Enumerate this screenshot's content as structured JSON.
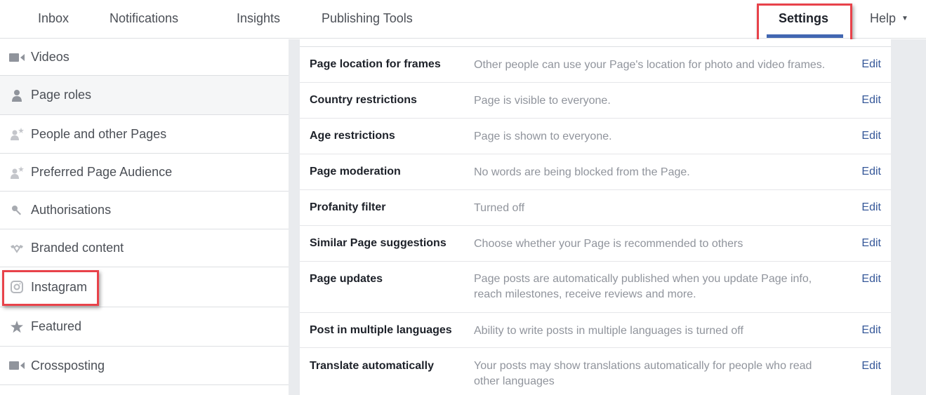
{
  "topnav": {
    "items": [
      {
        "label": "Inbox"
      },
      {
        "label": "Notifications"
      },
      {
        "label": "Insights"
      },
      {
        "label": "Publishing Tools"
      }
    ],
    "settings_label": "Settings",
    "help_label": "Help",
    "help_caret": "▼",
    "active": "Settings",
    "accent_color": "#4267b2",
    "highlight_color": "#e8424a"
  },
  "sidebar": {
    "items": [
      {
        "label": "Videos",
        "icon": "video-camera-icon"
      },
      {
        "label": "Page roles",
        "icon": "person-icon",
        "selected": true
      },
      {
        "label": "People and other Pages",
        "icon": "person-star-icon"
      },
      {
        "label": "Preferred Page Audience",
        "icon": "person-star-icon"
      },
      {
        "label": "Authorisations",
        "icon": "key-icon"
      },
      {
        "label": "Branded content",
        "icon": "handshake-icon"
      },
      {
        "label": "Instagram",
        "icon": "instagram-icon",
        "highlighted": true
      },
      {
        "label": "Featured",
        "icon": "star-icon"
      },
      {
        "label": "Crossposting",
        "icon": "video-camera-icon"
      }
    ]
  },
  "settings": {
    "edit_label": "Edit",
    "rows": [
      {
        "title": "Page location for frames",
        "description": "Other people can use your Page's location for photo and video frames."
      },
      {
        "title": "Country restrictions",
        "description": "Page is visible to everyone."
      },
      {
        "title": "Age restrictions",
        "description": "Page is shown to everyone."
      },
      {
        "title": "Page moderation",
        "description": "No words are being blocked from the Page."
      },
      {
        "title": "Profanity filter",
        "description": "Turned off"
      },
      {
        "title": "Similar Page suggestions",
        "description": "Choose whether your Page is recommended to others"
      },
      {
        "title": "Page updates",
        "description": "Page posts are automatically published when you update Page info, reach milestones, receive reviews and more."
      },
      {
        "title": "Post in multiple languages",
        "description": "Ability to write posts in multiple languages is turned off"
      },
      {
        "title": "Translate automatically",
        "description": "Your posts may show translations automatically for people who read other languages"
      }
    ]
  }
}
